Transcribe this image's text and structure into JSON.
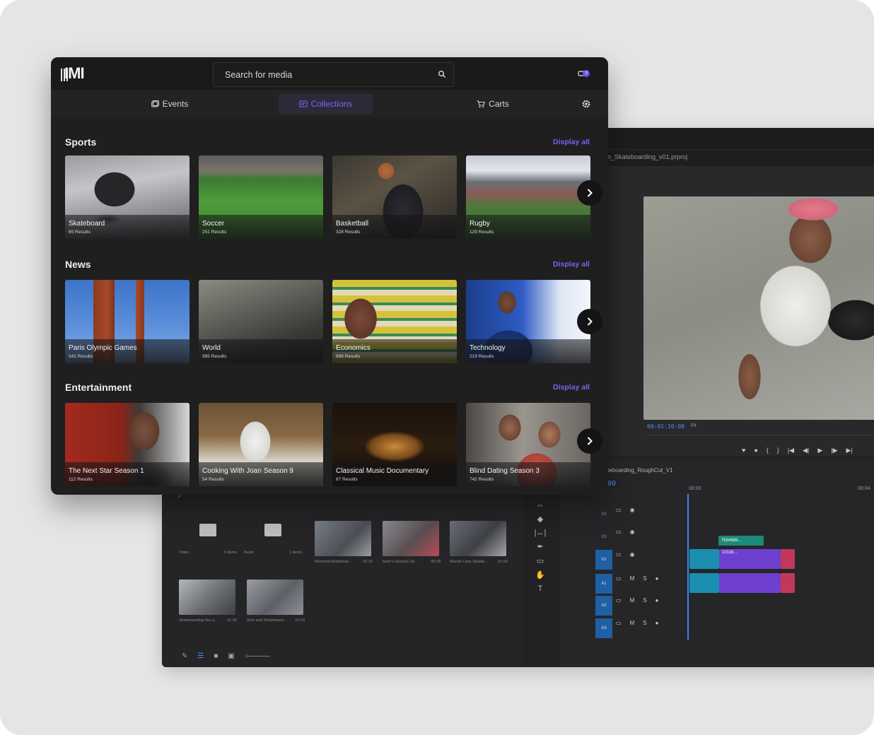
{
  "app": {
    "logo_text": "IMI",
    "search": {
      "placeholder": "Search for media"
    },
    "notification_count": "3",
    "tabs": [
      {
        "label": "Events",
        "icon": "events-icon",
        "active": false
      },
      {
        "label": "Collections",
        "icon": "collections-icon",
        "active": true
      },
      {
        "label": "Carts",
        "icon": "cart-icon",
        "active": false
      }
    ],
    "display_all_label": "Display all",
    "sections": [
      {
        "title": "Sports",
        "items": [
          {
            "title": "Skateboard",
            "count": "65 Results"
          },
          {
            "title": "Soccer",
            "count": "251 Results"
          },
          {
            "title": "Basketball",
            "count": "328 Results"
          },
          {
            "title": "Rugby",
            "count": "129 Results"
          }
        ]
      },
      {
        "title": "News",
        "items": [
          {
            "title": "Paris Olympic Games",
            "count": "542 Results"
          },
          {
            "title": "World",
            "count": "985 Results"
          },
          {
            "title": "Economics",
            "count": "698 Results"
          },
          {
            "title": "Technology",
            "count": "219 Results"
          }
        ]
      },
      {
        "title": "Entertainment",
        "items": [
          {
            "title": "The Next Star Season 1",
            "count": "112 Results"
          },
          {
            "title": "Cooking With Joan Season 9",
            "count": "54 Results"
          },
          {
            "title": "Classical Music Documentary",
            "count": "87 Results"
          },
          {
            "title": "Blind Dating Season 3",
            "count": "742 Results"
          }
        ]
      }
    ],
    "colors": {
      "accent": "#7565f0",
      "background": "#1f1f20"
    }
  },
  "premiere": {
    "project_title": "n_Skateboarding_v01.prproj",
    "program_timecode": "00:01:10:08",
    "fit_label": "Fit",
    "sequence_name": "teboarding_RoughCut_V1",
    "sequence_timecode": "00",
    "timeline_time_start": "00:00",
    "timeline_time_end": "00:04",
    "bin_items": [
      {
        "name": "Video",
        "count": "9 Items"
      },
      {
        "name": "Audio",
        "count": "1 Items"
      },
      {
        "name": "WomeninSkateboar...",
        "duration": "02:15"
      },
      {
        "name": "Noor's Hussain Sk...",
        "duration": "00:38"
      },
      {
        "name": "Mariah Lane Skateb...",
        "duration": "01:52"
      },
      {
        "name": "Skateboarding like a...",
        "duration": "01:30"
      },
      {
        "name": "Girls and Skateboard...",
        "duration": "12:03"
      }
    ],
    "tracks": [
      "V3",
      "V2",
      "V1",
      "A1",
      "A2",
      "A3"
    ],
    "clip_labels": {
      "clip_a": "7634689...",
      "clip_b": "10118..."
    },
    "track_buttons": {
      "mute": "M",
      "solo": "S"
    },
    "colors": {
      "timecode": "#4d8df0",
      "clip_video": "#6f3fcf",
      "clip_audio": "#1a8fb0"
    }
  }
}
